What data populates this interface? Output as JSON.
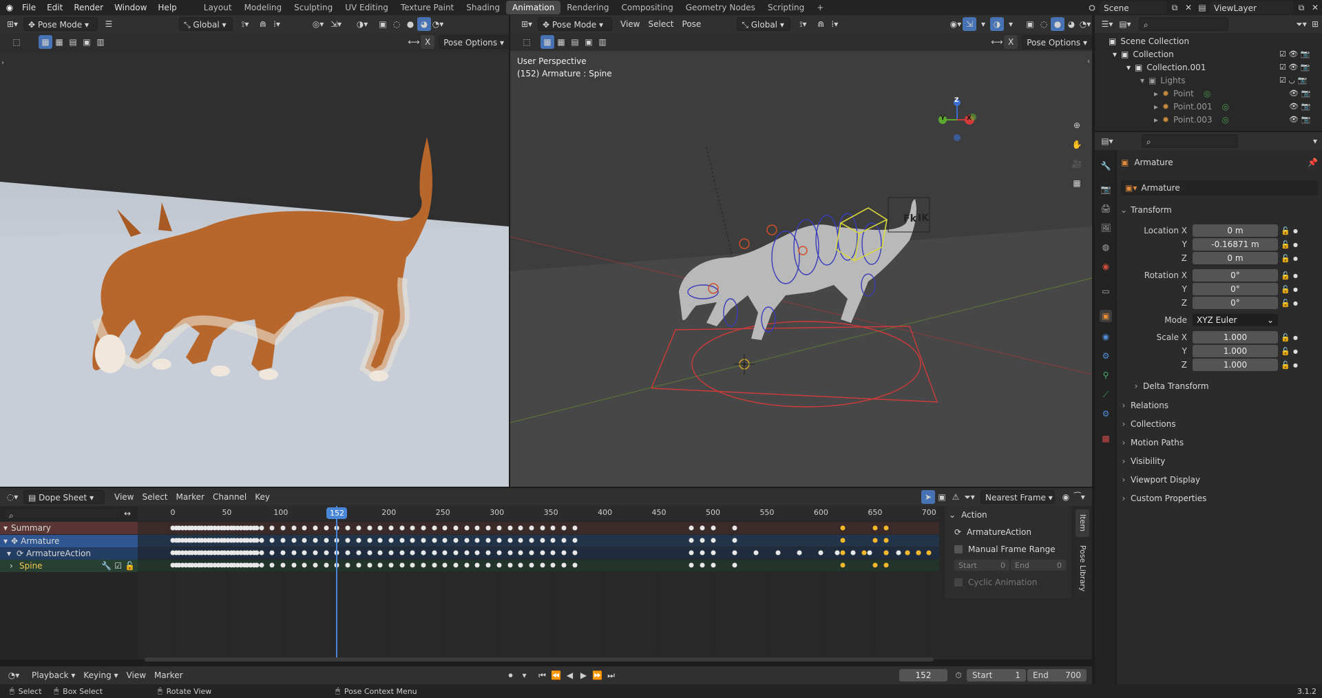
{
  "topbar": {
    "menus": [
      "File",
      "Edit",
      "Render",
      "Window",
      "Help"
    ],
    "workspaces": [
      "Layout",
      "Modeling",
      "Sculpting",
      "UV Editing",
      "Texture Paint",
      "Shading",
      "Animation",
      "Rendering",
      "Compositing",
      "Geometry Nodes",
      "Scripting"
    ],
    "active_workspace": "Animation",
    "scene": "Scene",
    "viewlayer": "ViewLayer",
    "add_tab": "+"
  },
  "left_view": {
    "mode": "Pose Mode",
    "transform": "Global",
    "pose_options": "Pose Options",
    "x_label": "X"
  },
  "right_view": {
    "mode": "Pose Mode",
    "menus": [
      "View",
      "Select",
      "Pose"
    ],
    "transform": "Global",
    "pose_options": "Pose Options",
    "x_label": "X",
    "overlay_line1": "User Perspective",
    "overlay_line2": "(152) Armature : Spine",
    "fk_label": "Fk",
    "ik_label": "IK",
    "gizmo": {
      "z": "Z",
      "y": "Y",
      "x": "X"
    }
  },
  "outliner": {
    "rows": [
      {
        "label": "Scene Collection",
        "indent": 0
      },
      {
        "label": "Collection",
        "indent": 1
      },
      {
        "label": "Collection.001",
        "indent": 2
      },
      {
        "label": "Lights",
        "indent": 3
      },
      {
        "label": "Point",
        "indent": 4
      },
      {
        "label": "Point.001",
        "indent": 4
      },
      {
        "label": "Point.003",
        "indent": 4
      }
    ]
  },
  "properties": {
    "object_name": "Armature",
    "data_name": "Armature",
    "transform_title": "Transform",
    "location": {
      "label": "Location X",
      "x": "0 m",
      "y": "-0.16871 m",
      "z": "0 m"
    },
    "rotation": {
      "label": "Rotation X",
      "x": "0°",
      "y": "0°",
      "z": "0°"
    },
    "mode_label": "Mode",
    "mode_value": "XYZ Euler",
    "scale": {
      "label": "Scale X",
      "x": "1.000",
      "y": "1.000",
      "z": "1.000"
    },
    "y_label": "Y",
    "z_label": "Z",
    "delta": "Delta Transform",
    "panels": [
      "Relations",
      "Collections",
      "Motion Paths",
      "Visibility",
      "Viewport Display",
      "Custom Properties"
    ]
  },
  "dopesheet": {
    "editor": "Dope Sheet",
    "menus": [
      "View",
      "Select",
      "Marker",
      "Channel",
      "Key"
    ],
    "snap": "Nearest Frame",
    "current_frame": "152",
    "ticks": [
      "0",
      "50",
      "100",
      "150",
      "200",
      "250",
      "300",
      "350",
      "400",
      "450",
      "500",
      "550",
      "600",
      "650",
      "700"
    ],
    "channels": [
      "Summary",
      "Armature",
      "ArmatureAction",
      "Spine"
    ],
    "action_panel": {
      "title": "Action",
      "action_name": "ArmatureAction",
      "manual_range": "Manual Frame Range",
      "start_label": "Start",
      "start_val": "0",
      "end_label": "End",
      "end_val": "0",
      "cyclic": "Cyclic Animation"
    },
    "tabs": [
      "Item",
      "Pose Library"
    ]
  },
  "timeline": {
    "menus": [
      "Playback",
      "Keying",
      "View",
      "Marker"
    ],
    "frame": "152",
    "start_label": "Start",
    "start": "1",
    "end_label": "End",
    "end": "700"
  },
  "status": {
    "select": "Select",
    "box": "Box Select",
    "rotate": "Rotate View",
    "context": "Pose Context Menu",
    "version": "3.1.2"
  }
}
